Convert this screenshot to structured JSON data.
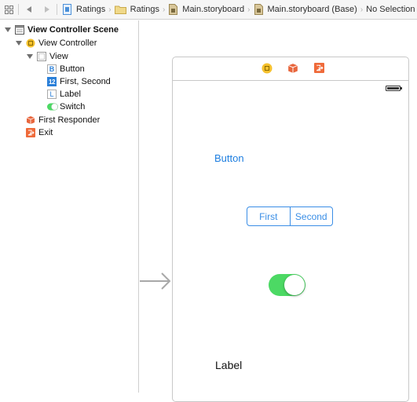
{
  "toolbar": {
    "grid_icon": "related-items-grid-icon",
    "back_icon": "back-arrow-icon",
    "forward_icon": "forward-arrow-icon",
    "breadcrumbs": [
      {
        "label": "Ratings",
        "icon": "project-file-icon"
      },
      {
        "label": "Ratings",
        "icon": "folder-icon"
      },
      {
        "label": "Main.storyboard",
        "icon": "storyboard-file-icon"
      },
      {
        "label": "Main.storyboard (Base)",
        "icon": "storyboard-file-icon"
      },
      {
        "label": "No Selection",
        "icon": ""
      }
    ],
    "separator": "›"
  },
  "outline": {
    "items": [
      {
        "label": "View Controller Scene",
        "icon": "scene-icon",
        "level": 0,
        "expanded": true
      },
      {
        "label": "View Controller",
        "icon": "view-controller-icon",
        "level": 1,
        "expanded": true
      },
      {
        "label": "View",
        "icon": "view-icon",
        "level": 2,
        "expanded": true
      },
      {
        "label": "Button",
        "icon": "button-icon",
        "level": 3,
        "glyph": "B"
      },
      {
        "label": "First, Second",
        "icon": "segmented-control-icon",
        "level": 3,
        "glyph": "12"
      },
      {
        "label": "Label",
        "icon": "label-icon",
        "level": 3,
        "glyph": "L"
      },
      {
        "label": "Switch",
        "icon": "switch-icon",
        "level": 3
      },
      {
        "label": "First Responder",
        "icon": "first-responder-icon",
        "level": 1
      },
      {
        "label": "Exit",
        "icon": "exit-icon",
        "level": 1
      }
    ]
  },
  "canvas": {
    "scene_dock_icons": [
      "view-controller-icon",
      "first-responder-icon",
      "exit-icon"
    ],
    "button_title": "Button",
    "segments": [
      "First",
      "Second"
    ],
    "switch_on": true,
    "label_text": "Label"
  },
  "colors": {
    "ios_tint": "#1f7fe0",
    "switch_on": "#4cd964",
    "vc_yellow": "#f5c12e",
    "responder_orange": "#e8663d",
    "exit_orange": "#ef6a3a"
  }
}
